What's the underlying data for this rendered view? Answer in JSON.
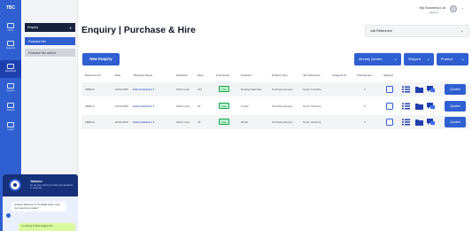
{
  "rail": {
    "brand": "TBC",
    "items": [
      {
        "label": "Home"
      },
      {
        "label": "Requests"
      },
      {
        "label": "Dashboard"
      },
      {
        "label": "Reports"
      },
      {
        "label": "Support"
      },
      {
        "label": "Logout"
      }
    ]
  },
  "subnav": {
    "heading": "Enquiry",
    "items": [
      {
        "label": "Purchase Hire"
      },
      {
        "label": "Purchase Hire archive"
      }
    ]
  },
  "user": {
    "business": "My Business Ltd",
    "sub": "address"
  },
  "page": {
    "title": "Enquiry | Purchase & Hire",
    "job_reference_label": "Job Reference",
    "new_enquiry_label": "New Enquiry"
  },
  "filters": {
    "already_quoted": "Already Quoted",
    "shipped": "Shipped",
    "product": "Product"
  },
  "table": {
    "headers": [
      "Reference ID",
      "Date",
      "Business Name",
      "Postcode",
      "Days",
      "Live/Tender",
      "Products",
      "Product Type",
      "Job Reference",
      "Assigned To",
      "Total Quotes",
      "Shipped"
    ],
    "rows": [
      {
        "ref": "ZB6012",
        "date": "20/01/2025",
        "business": "Sub-Contractor 1",
        "postcode": "SW1A 1AA",
        "days": "193",
        "status": "Live",
        "products": "Roofing Materials",
        "type": "Purchase Enquiry",
        "jobref": "South Yorkshire",
        "assigned": "",
        "quotes": "3",
        "action": "Quotes"
      },
      {
        "ref": "ZB6013",
        "date": "21/01/2025",
        "business": "Sub-Contractor 1",
        "postcode": "SW1A 1AA",
        "days": "20",
        "status": "Live",
        "products": "Timber",
        "type": "Purchase Enquiry",
        "jobref": "North Yorkshire",
        "assigned": "",
        "quotes": "5",
        "action": "Quotes"
      },
      {
        "ref": "ZB6012",
        "date": "20/01/2025",
        "business": "Sub-Contractor 1",
        "postcode": "SW1A 1AA",
        "days": "20",
        "status": "Live",
        "products": "Bricks",
        "type": "Purchase Enquiry",
        "jobref": "North Yorkshire",
        "assigned": "",
        "quotes": "3",
        "action": "Quotes"
      }
    ]
  },
  "chat": {
    "agent_name": "Jackson",
    "preview": "Hi, we were told if you have any questions or requests...",
    "bubble": "Hi there! Welcome to The Build Chain. How can I assist you today?",
    "footer": "I'm having trouble logging into"
  },
  "colors": {
    "accent": "#2f5fd0",
    "dark_navy": "#16213e",
    "live_green": "#bbf7d0"
  }
}
